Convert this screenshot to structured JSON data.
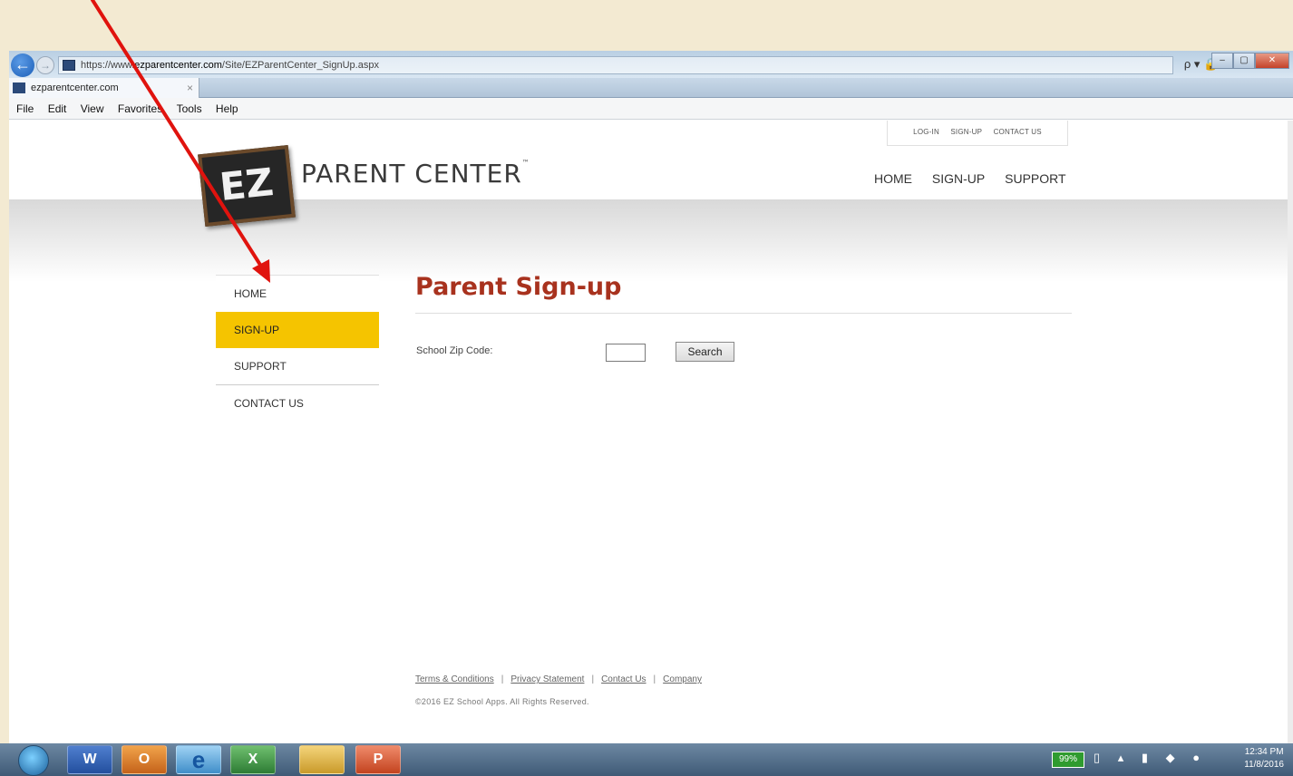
{
  "browser": {
    "url_prefix": "https://www.",
    "url_domain": "ezparentcenter.com",
    "url_path": "/Site/EZParentCenter_SignUp.aspx",
    "tab_title": "ezparentcenter.com",
    "tab_close": "×",
    "address_tools": "ρ ▾ 🔒 ¢",
    "fav_icons": "⌂ ☆ ⚙",
    "window_controls": [
      "–",
      "▢",
      "✕"
    ],
    "menu": [
      "File",
      "Edit",
      "View",
      "Favorites",
      "Tools",
      "Help"
    ]
  },
  "header": {
    "utility_nav": [
      "LOG-IN",
      "SIGN-UP",
      "CONTACT US"
    ],
    "logo_text": "EZ",
    "brand": "PARENT CENTER",
    "brand_tm": "™",
    "main_nav": [
      "HOME",
      "SIGN-UP",
      "SUPPORT"
    ]
  },
  "sidebar": {
    "items": [
      {
        "label": "HOME"
      },
      {
        "label": "SIGN-UP"
      },
      {
        "label": "SUPPORT"
      },
      {
        "label": "CONTACT US"
      }
    ]
  },
  "main": {
    "title": "Parent Sign-up",
    "zip_label": "School Zip Code:",
    "zip_value": "",
    "search_label": "Search"
  },
  "footer": {
    "links": [
      "Terms & Conditions",
      "Privacy Statement",
      "Contact Us",
      "Company"
    ],
    "separator": "|",
    "copyright": "©2016 EZ School Apps. All Rights Reserved."
  },
  "taskbar": {
    "buttons": [
      "W",
      "O",
      "e",
      "X",
      "",
      "P"
    ],
    "battery": "99%",
    "tray_icons": "▯ ▴ ▮ ◆ ●",
    "time": "12:34 PM",
    "date": "11/8/2016"
  },
  "colors": {
    "accent_yellow": "#f5c400",
    "title_red": "#a8321e",
    "annotation_arrow": "#e0130e"
  }
}
